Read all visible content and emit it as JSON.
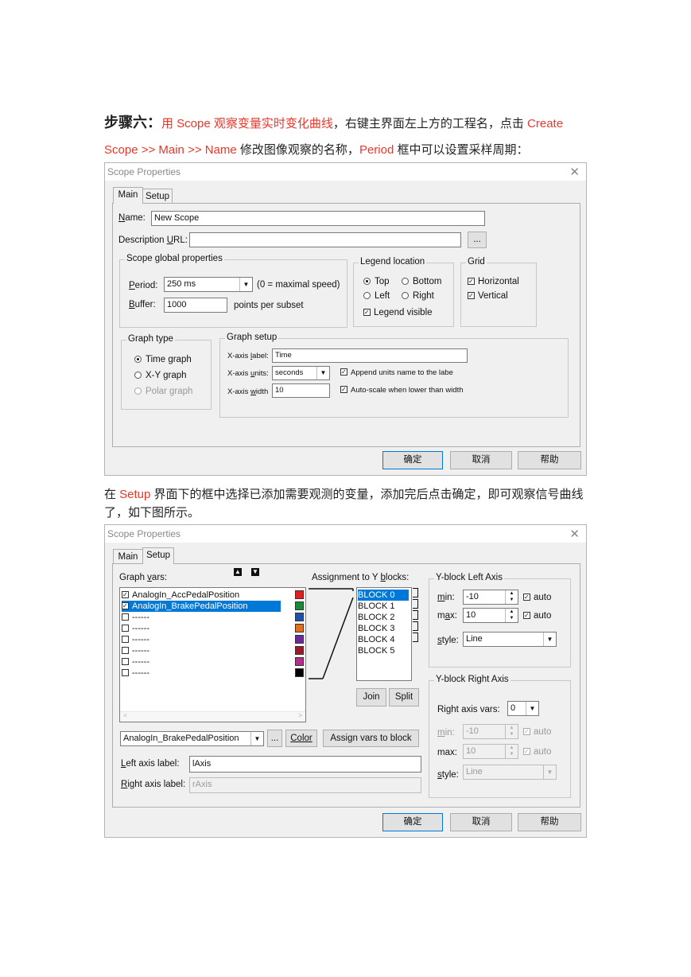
{
  "intro": {
    "step_label": "步骤六：",
    "part1": "用 Scope 观察变量实时变化曲线",
    "part2": "，右键主界面左上方的工程名，点击 ",
    "part3": "Create",
    "line2_red": "Scope >> Main >> Name",
    "line2_a": " 修改图像观察的名称，",
    "line2_red2": "Period",
    "line2_b": " 框中可以设置采样周期："
  },
  "between": {
    "red": "Setup",
    "a": " 界面下的框中选择已添加需要观测的变量，添加完后点击确定，即可观察信号曲线",
    "b": "了，如下图所示。",
    "prefix": "在 "
  },
  "dialog1": {
    "title": "Scope Properties",
    "close": "✕",
    "tabs": [
      "Main",
      "Setup"
    ],
    "name_label": "Name:",
    "name_value": "New Scope",
    "desc_label": "Description URL:",
    "desc_value": "",
    "browse": "...",
    "global_group": "Scope global properties",
    "period_label": "Period:",
    "period_value": "250 ms",
    "period_hint": "(0 = maximal speed)",
    "buffer_label": "Buffer:",
    "buffer_value": "1000",
    "buffer_hint": "points per subset",
    "legend_group": "Legend location",
    "legend_top": "Top",
    "legend_bottom": "Bottom",
    "legend_left": "Left",
    "legend_right": "Right",
    "legend_visible": "Legend visible",
    "grid_group": "Grid",
    "grid_h": "Horizontal",
    "grid_v": "Vertical",
    "graph_type_group": "Graph type",
    "gt_time": "Time graph",
    "gt_xy": "X-Y graph",
    "gt_polar": "Polar graph",
    "graph_setup_group": "Graph setup",
    "xlabel_label": "X-axis label:",
    "xlabel_value": "Time",
    "xunits_label": "X-axis units:",
    "xunits_value": "seconds",
    "append_units": "Append units name to the labe",
    "xwidth_label": "X-axis width",
    "xwidth_value": "10",
    "autoscale": "Auto-scale when lower than width",
    "ok": "确定",
    "cancel": "取消",
    "help": "帮助"
  },
  "dialog2": {
    "title": "Scope Properties",
    "close": "✕",
    "tabs": [
      "Main",
      "Setup"
    ],
    "graph_vars_label": "Graph vars:",
    "up_icon": "▲",
    "down_icon": "▼",
    "vars": [
      {
        "name": "AnalogIn_AccPedalPosition",
        "checked": true,
        "color": "#e02020"
      },
      {
        "name": "AnalogIn_BrakePedalPosition",
        "checked": true,
        "color": "#1a8a3a"
      },
      {
        "name": "------",
        "checked": false,
        "color": "#1f4fa8"
      },
      {
        "name": "------",
        "checked": false,
        "color": "#e07020"
      },
      {
        "name": "------",
        "checked": false,
        "color": "#6a2a9a"
      },
      {
        "name": "------",
        "checked": false,
        "color": "#9a1a2a"
      },
      {
        "name": "------",
        "checked": false,
        "color": "#b0308a"
      },
      {
        "name": "------",
        "checked": false,
        "color": "#000000"
      }
    ],
    "assign_label": "Assignment to Y blocks:",
    "blocks": [
      "BLOCK 0",
      "BLOCK 1",
      "BLOCK 2",
      "BLOCK 3",
      "BLOCK 4",
      "BLOCK 5"
    ],
    "join": "Join",
    "split": "Split",
    "combo_value": "AnalogIn_BrakePedalPosition",
    "dots": "...",
    "color_btn": "Color",
    "assign_btn": "Assign vars to block",
    "left_axis_label": "Left axis label:",
    "left_axis_value": "lAxis",
    "right_axis_label": "Right axis label:",
    "right_axis_value": "rAxis",
    "left_group": "Y-block Left Axis",
    "min_label": "min:",
    "min_value": "-10",
    "max_label": "max:",
    "max_value": "10",
    "auto": "auto",
    "style_label": "style:",
    "style_value": "Line",
    "right_group": "Y-block Right Axis",
    "right_vars_label": "Right axis vars:",
    "right_vars_value": "0",
    "ok": "确定",
    "cancel": "取消",
    "help": "帮助"
  }
}
